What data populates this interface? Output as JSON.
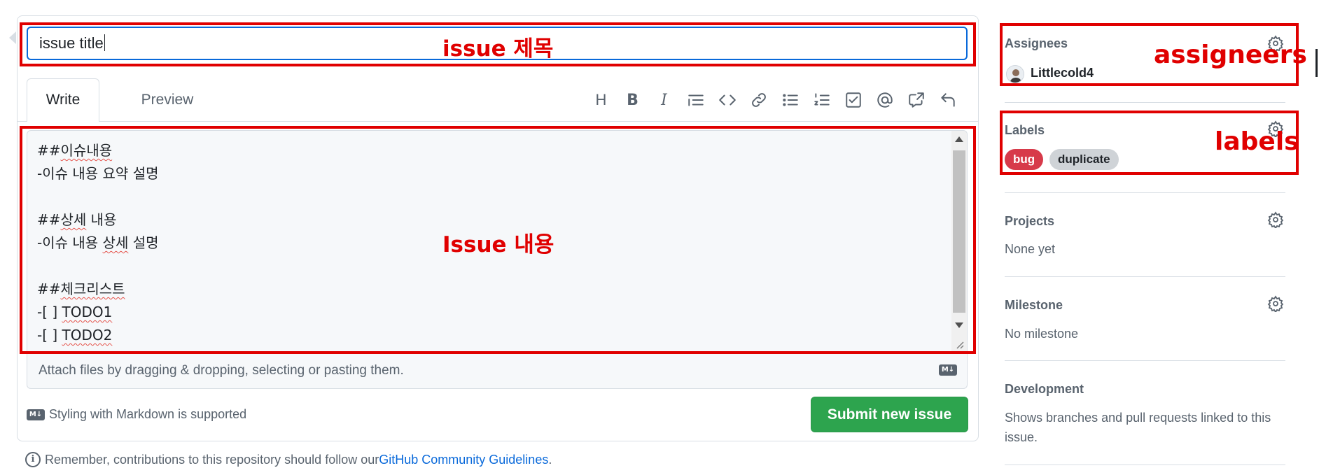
{
  "issue_title_input": {
    "value": "issue title"
  },
  "editor": {
    "tabs": [
      "Write",
      "Preview"
    ],
    "toolbar_icons": [
      "heading-icon",
      "bold-icon",
      "italic-icon",
      "quote-icon",
      "code-icon",
      "link-icon",
      "unordered-list-icon",
      "ordered-list-icon",
      "task-list-icon",
      "mention-icon",
      "cross-reference-icon",
      "undo-icon"
    ],
    "toolbar_letters": {
      "heading": "H",
      "bold": "B",
      "italic": "I"
    },
    "body_lines": [
      {
        "prefix": "##",
        "underlined": "이슈내용",
        "rest": ""
      },
      {
        "prefix": "-이슈 내용 요약 설명",
        "underlined": "",
        "rest": ""
      },
      {
        "prefix": "",
        "underlined": "",
        "rest": ""
      },
      {
        "prefix": "##",
        "underlined": "상세",
        "rest": " 내용"
      },
      {
        "prefix": "-이슈 내용 ",
        "underlined": "상세",
        "rest": " 설명"
      },
      {
        "prefix": "",
        "underlined": "",
        "rest": ""
      },
      {
        "prefix": "##",
        "underlined": "체크리스트",
        "rest": ""
      },
      {
        "prefix": "-[ ] ",
        "underlined": "TODO1",
        "rest": ""
      },
      {
        "prefix": "-[ ] ",
        "underlined": "TODO2",
        "rest": ""
      }
    ],
    "attach_text": "Attach files by dragging & dropping, selecting or pasting them.",
    "markdown_note": "Styling with Markdown is supported",
    "markdown_badge": "M↓",
    "submit_label": "Submit new issue"
  },
  "contribution_note": {
    "text": "Remember, contributions to this repository should follow our ",
    "link": "GitHub Community Guidelines",
    "suffix": ".",
    "icon": "i"
  },
  "sidebar": {
    "assignees": {
      "title": "Assignees",
      "user": "Littlecold4"
    },
    "labels": {
      "title": "Labels",
      "items": [
        {
          "name": "bug",
          "color": "#d73a4a"
        },
        {
          "name": "duplicate",
          "color": "#cfd3d7"
        }
      ]
    },
    "projects": {
      "title": "Projects",
      "value": "None yet"
    },
    "milestone": {
      "title": "Milestone",
      "value": "No milestone"
    },
    "development": {
      "title": "Development",
      "value_line1": "Shows branches and pull requests linked to this",
      "value_line2": "issue."
    }
  },
  "annotations": {
    "title_label": "issue 제목",
    "body_label": "Issue 내용",
    "assignees_label": "assigneers",
    "labels_label": "labels",
    "color": "#e00000"
  },
  "colors": {
    "accent_blue": "#0969da",
    "submit_green": "#2da44e"
  }
}
